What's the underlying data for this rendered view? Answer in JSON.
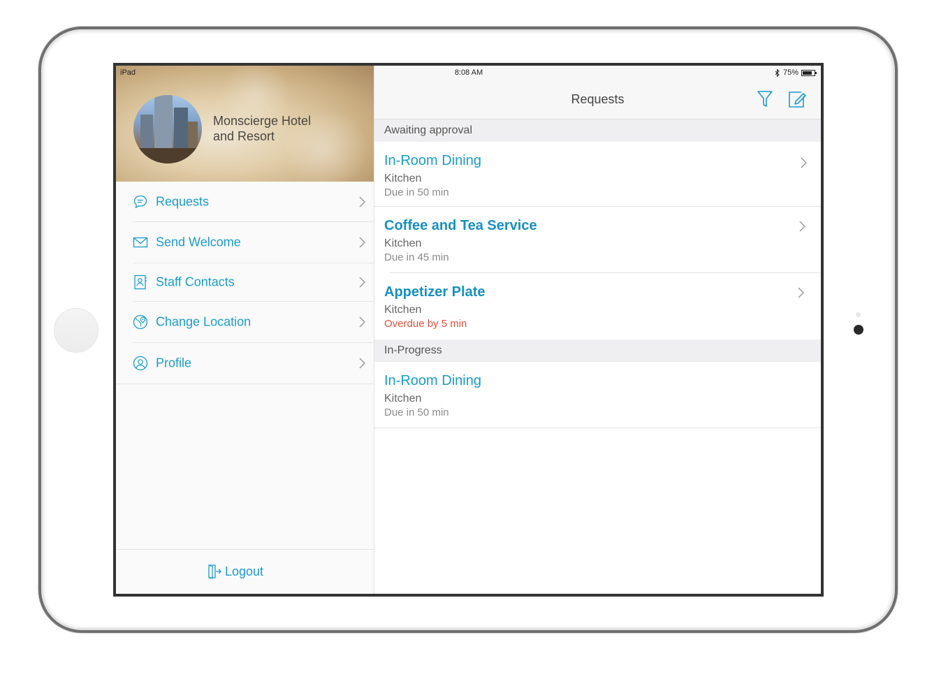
{
  "device": {
    "label": "iPad"
  },
  "status_bar": {
    "time": "8:08 AM",
    "battery": "75%"
  },
  "sidebar": {
    "hotel_name_line1": "Monscierge Hotel",
    "hotel_name_line2": "and Resort",
    "items": [
      {
        "label": "Requests",
        "icon": "chat-bubble-icon"
      },
      {
        "label": "Send Welcome",
        "icon": "envelope-icon"
      },
      {
        "label": "Staff Contacts",
        "icon": "contacts-book-icon"
      },
      {
        "label": "Change Location",
        "icon": "globe-pin-icon"
      },
      {
        "label": "Profile",
        "icon": "user-circle-icon"
      }
    ],
    "logout_label": "Logout"
  },
  "main": {
    "title": "Requests",
    "sections": [
      {
        "header": "Awaiting approval",
        "rows": [
          {
            "title": "In-Room Dining",
            "dept": "Kitchen",
            "due": "Due in 50 min",
            "overdue": false
          },
          {
            "title": "Coffee and Tea Service",
            "dept": "Kitchen",
            "due": "Due in 45 min",
            "overdue": false
          },
          {
            "title": "Appetizer Plate",
            "dept": "Kitchen",
            "due": "Overdue by 5 min",
            "overdue": true
          }
        ]
      },
      {
        "header": "In-Progress",
        "rows": [
          {
            "title": "In-Room Dining",
            "dept": "Kitchen",
            "due": "Due in 50 min",
            "overdue": false
          }
        ]
      }
    ]
  },
  "colors": {
    "accent": "#1a9ccc",
    "overdue": "#e0503c"
  }
}
